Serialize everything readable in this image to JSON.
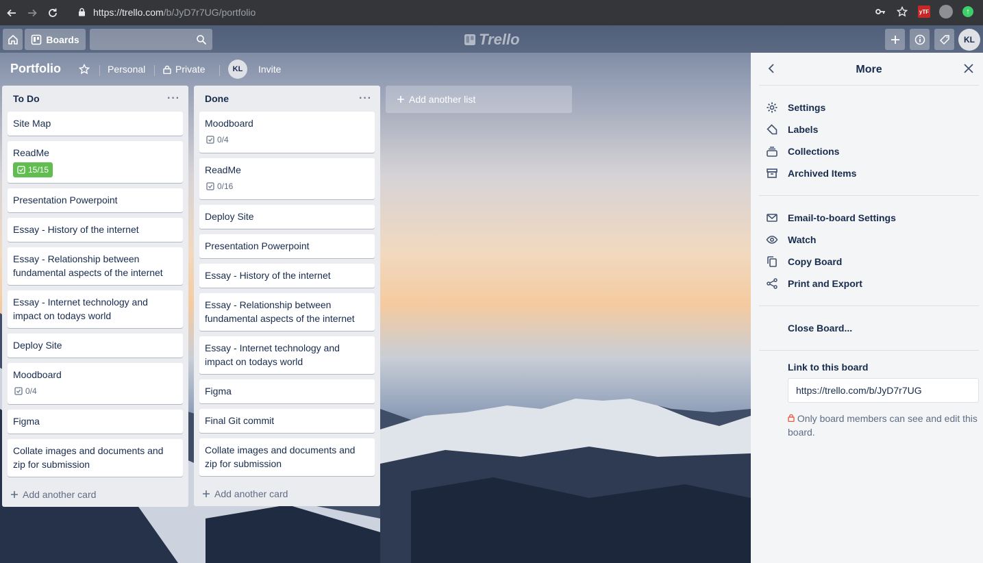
{
  "browser": {
    "url_host": "https://trello.com",
    "url_path": "/b/JyD7r7UG/portfolio"
  },
  "header": {
    "boards_label": "Boards",
    "logo_text": "Trello",
    "avatar_initials": "KL"
  },
  "board": {
    "title": "Portfolio",
    "team": "Personal",
    "visibility": "Private",
    "member_initials": "KL",
    "invite_label": "Invite"
  },
  "lists": [
    {
      "title": "To Do",
      "add_card_label": "Add another card",
      "cards": [
        {
          "title": "Site Map"
        },
        {
          "title": "ReadMe",
          "checklist": "15/15",
          "complete": true
        },
        {
          "title": "Presentation Powerpoint"
        },
        {
          "title": "Essay - History of the internet"
        },
        {
          "title": "Essay - Relationship between fundamental aspects of the internet"
        },
        {
          "title": "Essay - Internet technology and impact on todays world"
        },
        {
          "title": "Deploy Site"
        },
        {
          "title": "Moodboard",
          "checklist": "0/4",
          "complete": false
        },
        {
          "title": "Figma"
        },
        {
          "title": "Collate images and documents and zip for submission"
        }
      ]
    },
    {
      "title": "Done",
      "add_card_label": "Add another card",
      "cards": [
        {
          "title": "Moodboard",
          "checklist": "0/4",
          "complete": false
        },
        {
          "title": "ReadMe",
          "checklist": "0/16",
          "complete": false
        },
        {
          "title": "Deploy Site"
        },
        {
          "title": "Presentation Powerpoint"
        },
        {
          "title": "Essay - History of the internet"
        },
        {
          "title": "Essay - Relationship between fundamental aspects of the internet"
        },
        {
          "title": "Essay - Internet technology and impact on todays world"
        },
        {
          "title": "Figma"
        },
        {
          "title": "Final Git commit"
        },
        {
          "title": "Collate images and documents and zip for submission"
        }
      ]
    }
  ],
  "add_list_label": "Add another list",
  "menu": {
    "title": "More",
    "items": [
      {
        "label": "Settings",
        "icon": "gear-icon"
      },
      {
        "label": "Labels",
        "icon": "label-icon"
      },
      {
        "label": "Collections",
        "icon": "collections-icon"
      },
      {
        "label": "Archived Items",
        "icon": "archive-icon"
      },
      {
        "label": "Email-to-board Settings",
        "icon": "email-icon"
      },
      {
        "label": "Watch",
        "icon": "eye-icon"
      },
      {
        "label": "Copy Board",
        "icon": "copy-icon"
      },
      {
        "label": "Print and Export",
        "icon": "share-icon"
      }
    ],
    "close_board_label": "Close Board...",
    "link_label": "Link to this board",
    "link_value": "https://trello.com/b/JyD7r7UG",
    "privacy_note": "Only board members can see and edit this board."
  }
}
